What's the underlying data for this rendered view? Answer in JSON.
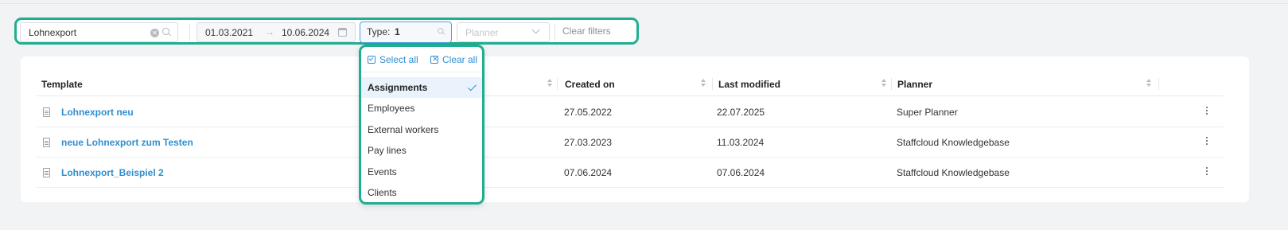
{
  "filters": {
    "search_value": "Lohnexport",
    "date_start": "01.03.2021",
    "date_arrow": "→",
    "date_end": "10.06.2024",
    "type_label": "Type:",
    "type_value": "1",
    "planner_placeholder": "Planner",
    "clear_filters_label": "Clear filters"
  },
  "table": {
    "columns": [
      "Template",
      "Created on",
      "Last modified",
      "Planner"
    ],
    "rows": [
      {
        "name": "Lohnexport neu",
        "created": "27.05.2022",
        "modified": "22.07.2025",
        "planner": "Super Planner"
      },
      {
        "name": "neue Lohnexport zum Testen",
        "created": "27.03.2023",
        "modified": "11.03.2024",
        "planner": "Staffcloud Knowledgebase"
      },
      {
        "name": "Lohnexport_Beispiel 2",
        "created": "07.06.2024",
        "modified": "07.06.2024",
        "planner": "Staffcloud Knowledgebase"
      }
    ]
  },
  "type_dropdown": {
    "select_all_label": "Select all",
    "clear_all_label": "Clear all",
    "options": [
      {
        "label": "Assignments",
        "selected": true
      },
      {
        "label": "Employees",
        "selected": false
      },
      {
        "label": "External workers",
        "selected": false
      },
      {
        "label": "Pay lines",
        "selected": false
      },
      {
        "label": "Events",
        "selected": false
      },
      {
        "label": "Clients",
        "selected": false
      }
    ]
  },
  "colors": {
    "highlight": "#1fae91",
    "accent": "#2f8fd0",
    "background": "#f2f3f5"
  }
}
